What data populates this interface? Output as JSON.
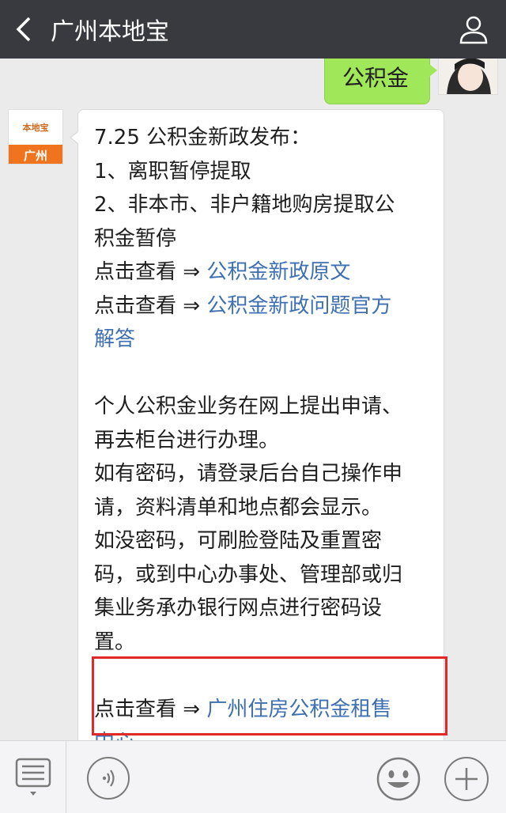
{
  "header": {
    "title": "广州本地宝",
    "back_icon": "chevron-left-icon",
    "profile_icon": "person-icon"
  },
  "chat": {
    "sent_message": "公积金",
    "bot_avatar": {
      "logo_text": "本地宝",
      "city_label": "广州"
    },
    "message": {
      "l1": "7.25 公积金新政发布：",
      "l2": "1、离职暂停提取",
      "l3": "2、非本市、非户籍地购房提取公",
      "l4": "积金暂停",
      "l5_prefix": "点击查看 ⇒ ",
      "l5_link": "公积金新政原文",
      "l6_prefix": "点击查看 ⇒ ",
      "l6_link": "公积金新政问题官方",
      "l7_link": "解答",
      "p2_l1": "个人公积金业务在网上提出申请、",
      "p2_l2": "再去柜台进行办理。",
      "p2_l3": "如有密码，请登录后台自己操作申",
      "p2_l4": "请，资料清单和地点都会显示。",
      "p2_l5": "如没密码，可刷脸登陆及重置密",
      "p2_l6": "码，或到中心办事处、管理部或归",
      "p2_l7": "集业务承办银行网点进行密码设",
      "p2_l8": "置。",
      "p3_prefix": "点击查看 ⇒ ",
      "p3_link": "广州住房公积金租售",
      "p3_link2": "中心"
    }
  },
  "toolbar": {
    "menu_icon": "menu-list-icon",
    "voice_icon": "voice-icon",
    "emoji_icon": "smiley-icon",
    "plus_icon": "plus-icon"
  },
  "colors": {
    "header_bg": "#393a3f",
    "link": "#3d6fb1",
    "sent_bubble": "#a0e75a",
    "highlight": "#e02a2a"
  }
}
